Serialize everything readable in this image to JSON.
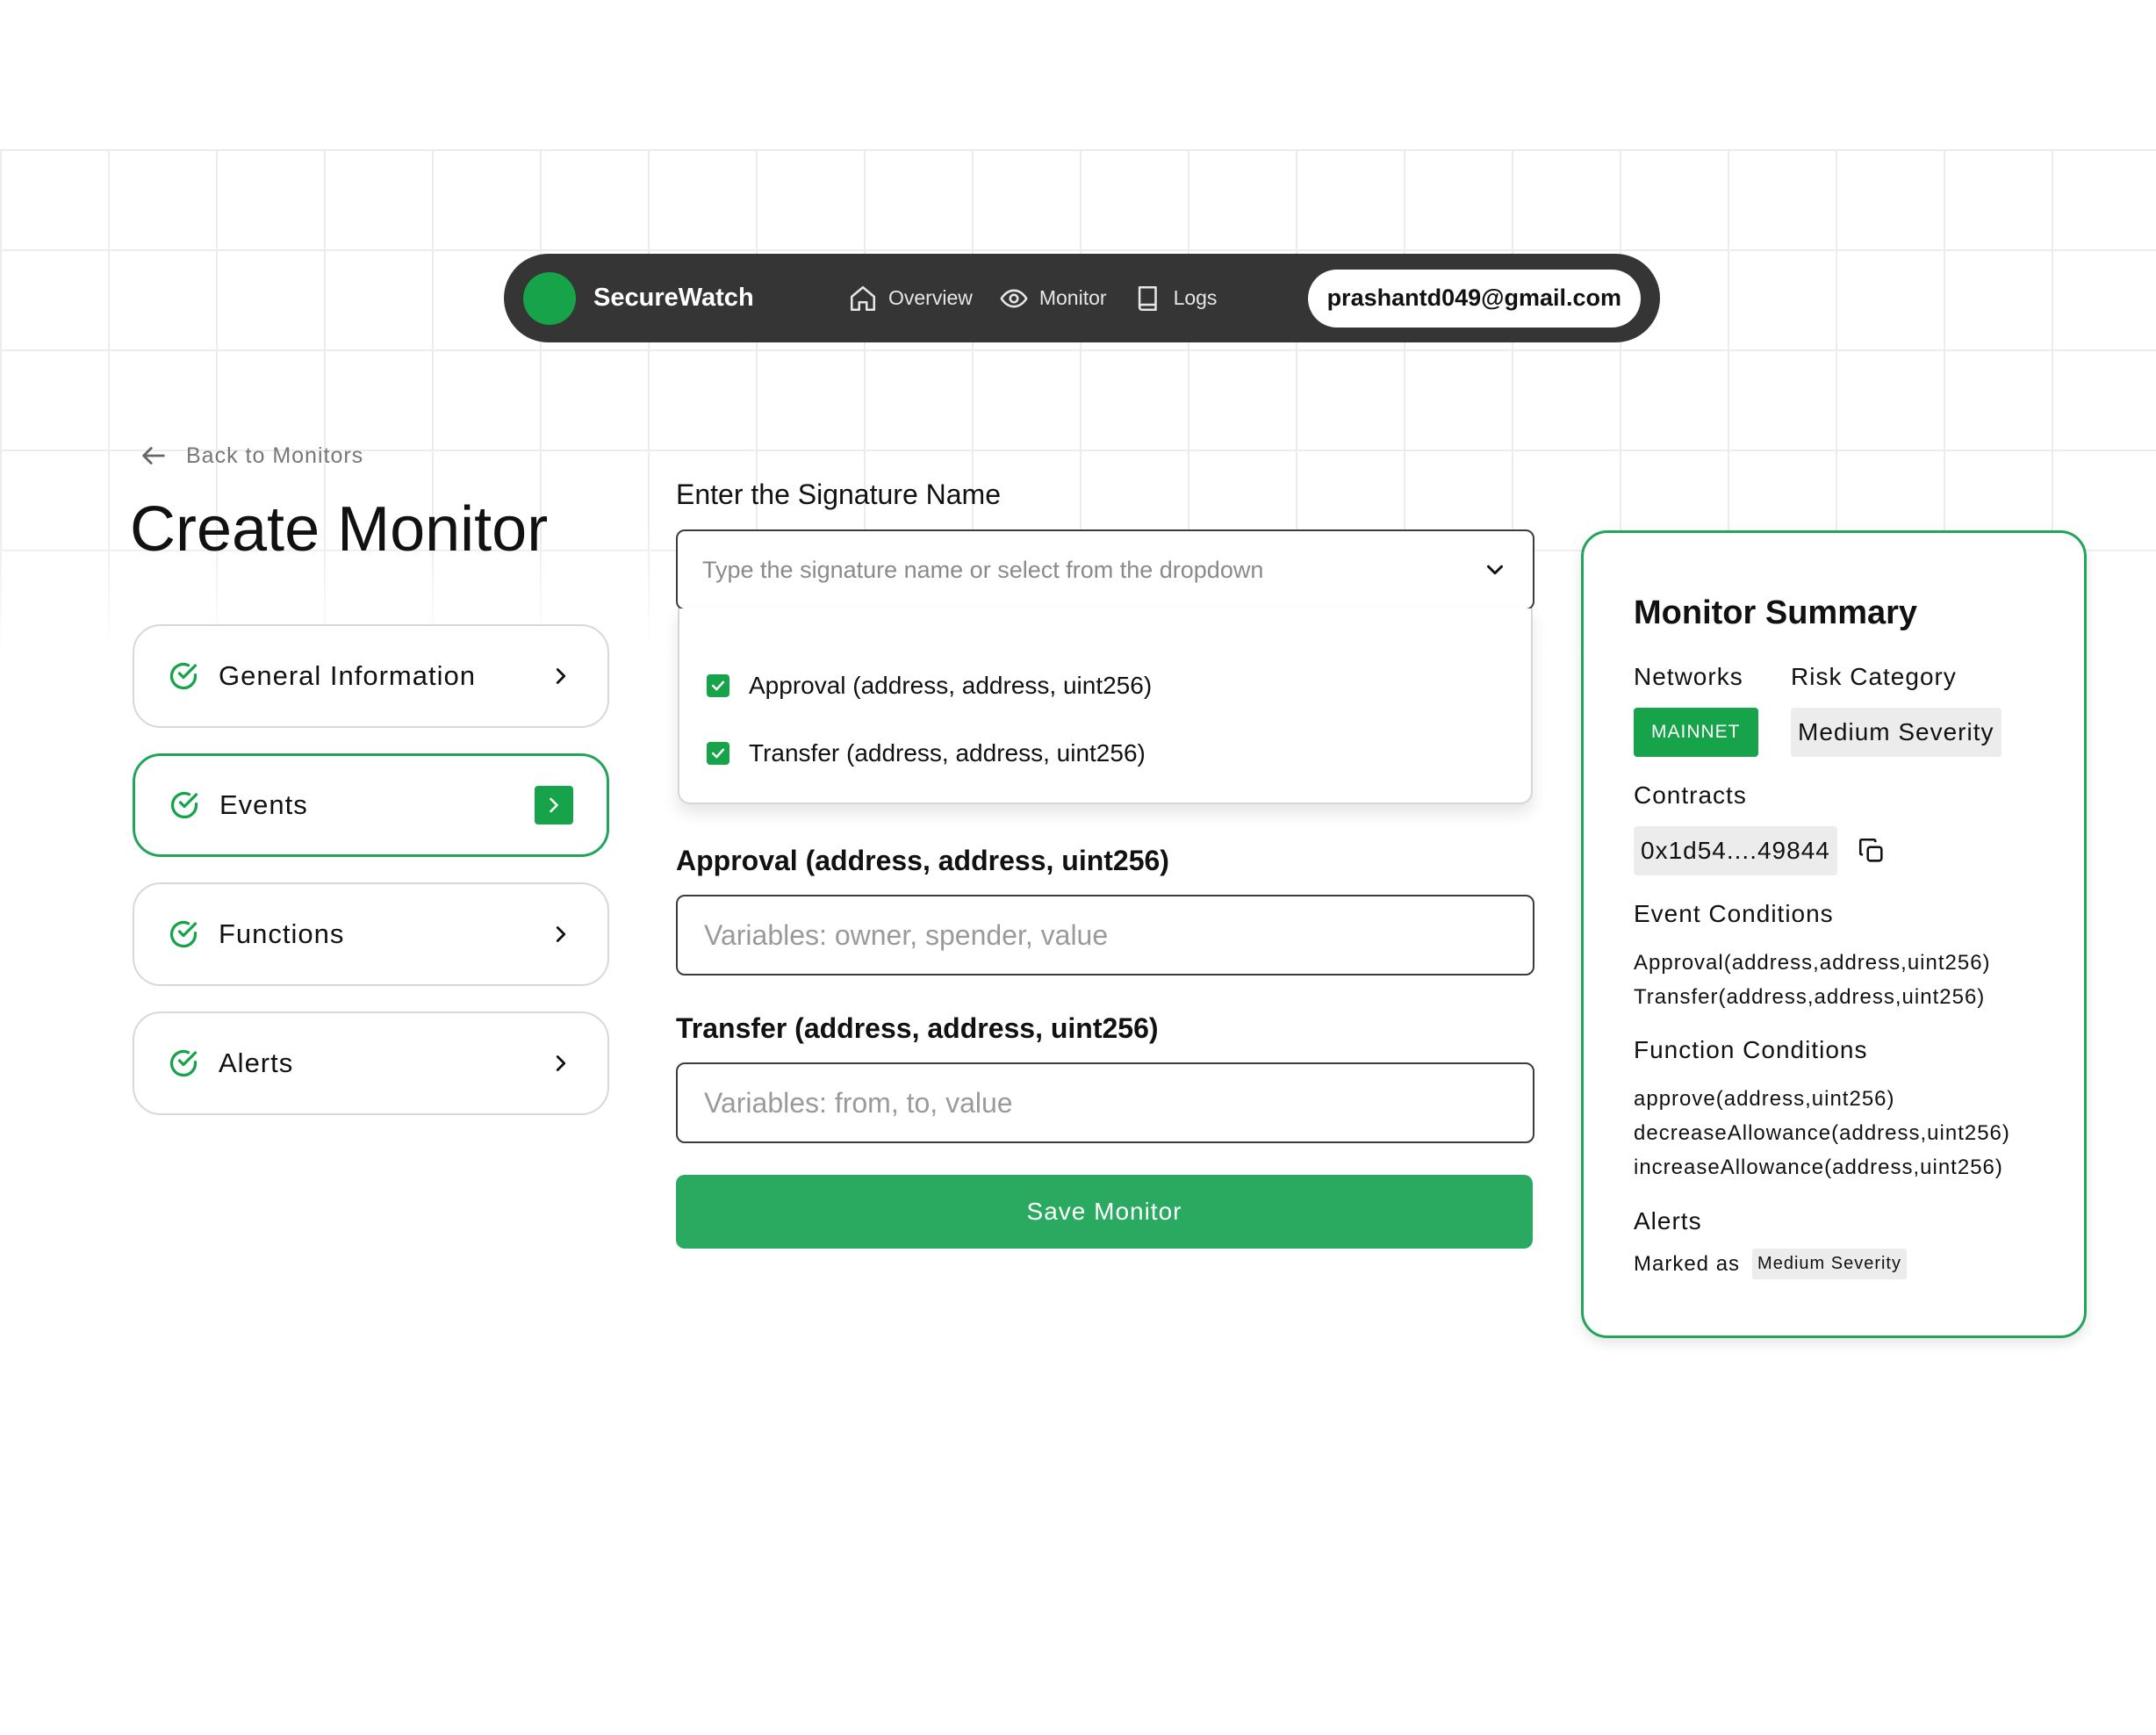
{
  "brand": {
    "name": "SecureWatch",
    "dot_color": "#17a34a"
  },
  "nav": {
    "links": [
      {
        "label": "Overview",
        "icon": "home-icon"
      },
      {
        "label": "Monitor",
        "icon": "eye-icon"
      },
      {
        "label": "Logs",
        "icon": "book-icon"
      }
    ],
    "user_email": "prashantd049@gmail.com"
  },
  "back_link": "Back to Monitors",
  "page_title": "Create Monitor",
  "steps": [
    {
      "label": "General Information",
      "active": false
    },
    {
      "label": "Events",
      "active": true
    },
    {
      "label": "Functions",
      "active": false
    },
    {
      "label": "Alerts",
      "active": false
    }
  ],
  "form": {
    "signature_label": "Enter the Signature Name",
    "signature_placeholder": "Type the signature name or select from the dropdown",
    "options": [
      {
        "label": "Approval (address, address, uint256)",
        "checked": true
      },
      {
        "label": "Transfer (address, address, uint256)",
        "checked": true
      }
    ],
    "approval_label": "Approval (address, address, uint256)",
    "approval_placeholder": "Variables: owner, spender, value",
    "transfer_label": "Transfer (address, address, uint256)",
    "transfer_placeholder": "Variables: from, to, value",
    "save_label": "Save Monitor"
  },
  "summary": {
    "title": "Monitor Summary",
    "networks_label": "Networks",
    "network": "MAINNET",
    "risk_label": "Risk Category",
    "risk": "Medium Severity",
    "contracts_label": "Contracts",
    "contract": "0x1d54....49844",
    "event_conditions_label": "Event Conditions",
    "event_conditions": [
      "Approval(address,address,uint256)",
      "Transfer(address,address,uint256)"
    ],
    "function_conditions_label": "Function Conditions",
    "function_conditions": [
      "approve(address,uint256)",
      "decreaseAllowance(address,uint256)",
      "increaseAllowance(address,uint256)"
    ],
    "alerts_label": "Alerts",
    "marked_as": "Marked as",
    "alert_severity": "Medium Severity"
  },
  "colors": {
    "accent": "#17a34a",
    "button": "#29aa60",
    "nav_bg": "#353535"
  }
}
